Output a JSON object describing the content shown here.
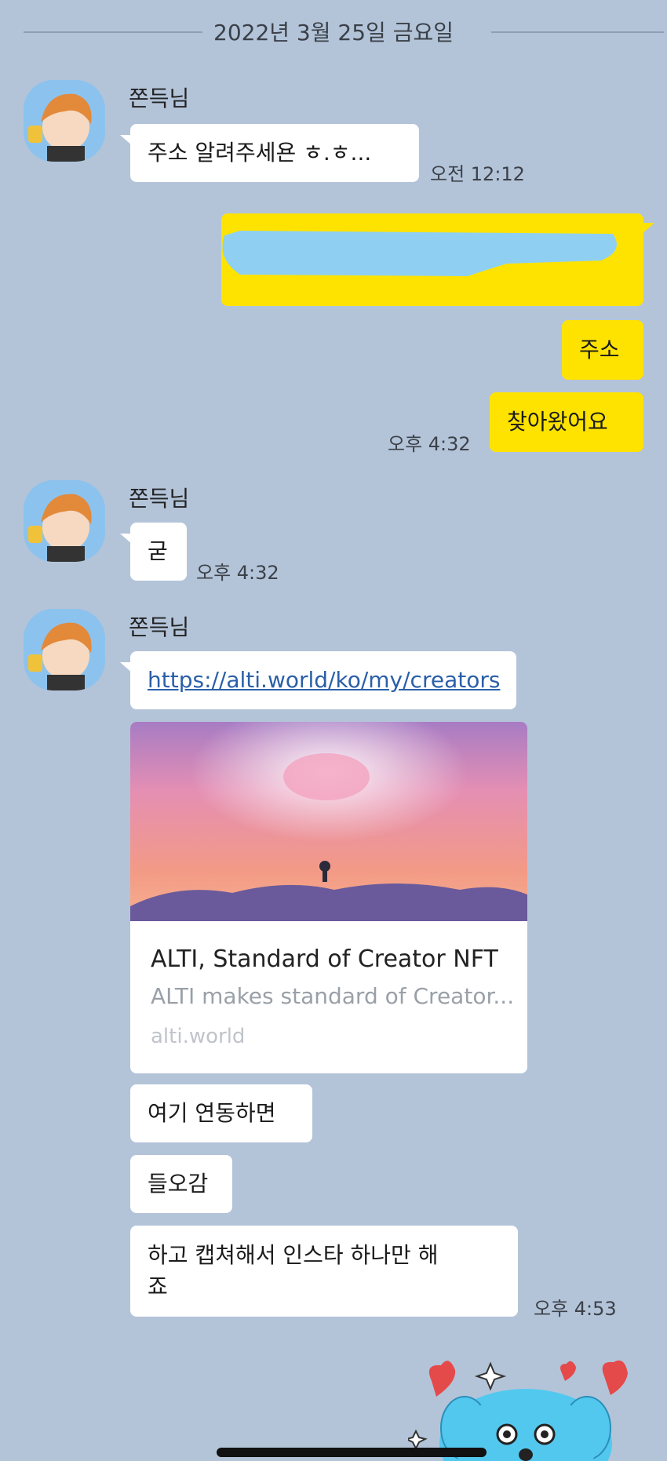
{
  "date_divider": "2022년 3월 25일 금요일",
  "sender_name": "쫀득님",
  "messages": {
    "m1": {
      "text": "주소 알려주세욘 ㅎ.ㅎ...",
      "time": "오전 12:12"
    },
    "m2": {
      "text": "주소"
    },
    "m3": {
      "text": "찾아왔어요",
      "time": "오후 4:32"
    },
    "m4": {
      "text": "굳",
      "time": "오후 4:32"
    },
    "m5": {
      "text": "https://alti.world/ko/my/creators"
    },
    "m6": {
      "text": "여기 연동하면"
    },
    "m7": {
      "text": "들오감"
    },
    "m8": {
      "line1": "하고 캡쳐해서 인스타 하나만 해",
      "line2": "죠",
      "time": "오후 4:53"
    }
  },
  "link_preview": {
    "title": "ALTI, Standard of Creator NFT",
    "description": "ALTI makes standard of Creator...",
    "domain": "alti.world"
  },
  "colors": {
    "background": "#b3c4d9",
    "my_bubble": "#fee300",
    "their_bubble": "#ffffff",
    "redaction": "#8fd0f2"
  }
}
